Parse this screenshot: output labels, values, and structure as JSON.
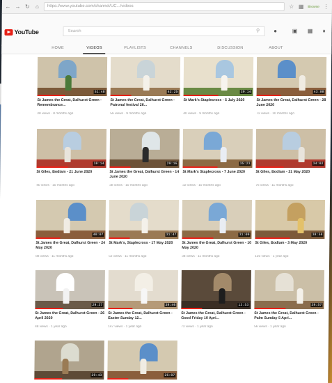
{
  "browser": {
    "url": "https://www.youtube.com/channel/UC.../videos",
    "badge": "Browse"
  },
  "youtube": {
    "logo": "YouTube",
    "search_placeholder": "Search",
    "tabs": [
      "HOME",
      "VIDEOS",
      "PLAYLISTS",
      "CHANNELS",
      "DISCUSSION",
      "ABOUT"
    ],
    "active_tab": "VIDEOS"
  },
  "colors": {
    "accent": "#e62117",
    "text": "#222222",
    "meta": "#999999"
  },
  "videos": [
    {
      "title": "St James the Great, Dalhurst Green - Remembrance...",
      "meta": "38 views · 8 months ago",
      "duration": "51:48",
      "scene": "altar-green",
      "watched": 0.4
    },
    {
      "title": "St James the Great, Dalhurst Green - Patronal festival 26...",
      "meta": "56 views · 9 months ago",
      "duration": "42:25",
      "scene": "nave-light",
      "watched": 0.3
    },
    {
      "title": "St Mark's Staplecross - 5 July 2020",
      "meta": "40 views · 9 months ago",
      "duration": "39:14",
      "scene": "altar-bright",
      "watched": 0.5
    },
    {
      "title": "St James the Great, Dalhurst Green - 28 June 2020",
      "meta": "72 views · 10 months ago",
      "duration": "43:08",
      "scene": "altar-window",
      "watched": 0.35
    },
    {
      "title": "St Giles, Bodiam - 21 June 2020",
      "meta": "40 views · 10 months ago",
      "duration": "38:14",
      "scene": "altar-red",
      "watched": 0.45
    },
    {
      "title": "St James the Great, Dalhurst Green - 14 June 2020",
      "meta": "38 views · 10 months ago",
      "duration": "29:16",
      "scene": "nave-dark",
      "watched": 0.3
    },
    {
      "title": "St Mark's Staplecross - 7 June 2020",
      "meta": "32 views · 10 months ago",
      "duration": "35:23",
      "scene": "altar-blue",
      "watched": 0.5
    },
    {
      "title": "St Giles, Bodiam - 31 May 2020",
      "meta": "76 views · 11 months ago",
      "duration": "34:02",
      "scene": "altar-red",
      "watched": 0.4
    },
    {
      "title": "St James the Great, Dalhurst Green - 24 May 2020",
      "meta": "88 views · 11 months ago",
      "duration": "40:07",
      "scene": "altar-window",
      "watched": 0.35
    },
    {
      "title": "St Mark's, Staplecross - 17 May 2020",
      "meta": "52 views · 11 months ago",
      "duration": "31:47",
      "scene": "nave-light",
      "watched": 0.3
    },
    {
      "title": "St James the Great, Dalhurst Green - 10 May 2020",
      "meta": "38 views · 11 months ago",
      "duration": "31:09",
      "scene": "altar-blue",
      "watched": 0.45
    },
    {
      "title": "St Giles, Bodiam - 3 May 2020",
      "meta": "120 views · 1 year ago",
      "duration": "38:58",
      "scene": "altar-gold",
      "watched": 0.5
    },
    {
      "title": "St James the Great, Dalhurst Green - 26 April 2020",
      "meta": "48 views · 1 year ago",
      "duration": "29:37",
      "scene": "room-white",
      "watched": 0.4
    },
    {
      "title": "St James the Great, Dalhurst Green - Easter Sunday 12...",
      "meta": "147 views · 1 year ago",
      "duration": "39:46",
      "scene": "room-door",
      "watched": 0.35
    },
    {
      "title": "St James the Great, Dalhurst Green - Good Friday 10 Apri...",
      "meta": "73 views · 1 year ago",
      "duration": "13:53",
      "scene": "room-dark",
      "watched": 0.3
    },
    {
      "title": "St James the Great, Dalhurst Green - Palm Sunday 5 Apri...",
      "meta": "56 views · 1 year ago",
      "duration": "39:57",
      "scene": "room-shelves",
      "watched": 0.45
    },
    {
      "title": "",
      "meta": "",
      "duration": "29:43",
      "scene": "room-window",
      "watched": 0.4
    },
    {
      "title": "",
      "meta": "",
      "duration": "26:07",
      "scene": "altar-window",
      "watched": 0.3
    }
  ]
}
